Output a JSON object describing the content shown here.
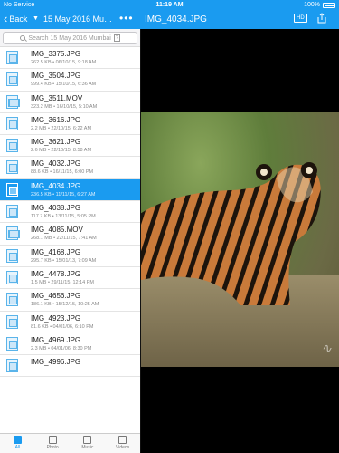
{
  "status": {
    "carrier": "No Service",
    "time": "11:19 AM",
    "battery": "100%"
  },
  "nav": {
    "back_label": "Back",
    "folder_title": "15 May 2016 Mumbai",
    "more": "•••",
    "file_title": "IMG_4034.JPG",
    "hd_label": "HD"
  },
  "search": {
    "placeholder": "Search 15 May 2016 Mumbai"
  },
  "files": [
    {
      "name": "IMG_3375.JPG",
      "meta": "262.5 KB • 06/10/15, 9:18 AM",
      "type": "image"
    },
    {
      "name": "IMG_3504.JPG",
      "meta": "999.4 KB • 15/10/15, 6:36 AM",
      "type": "image"
    },
    {
      "name": "IMG_3511.MOV",
      "meta": "323.2 MB • 16/10/15, 5:10 AM",
      "type": "video"
    },
    {
      "name": "IMG_3616.JPG",
      "meta": "2.2 MB • 22/10/15, 6:22 AM",
      "type": "image"
    },
    {
      "name": "IMG_3621.JPG",
      "meta": "2.6 MB • 22/10/15, 8:58 AM",
      "type": "image"
    },
    {
      "name": "IMG_4032.JPG",
      "meta": "88.6 KB • 16/11/15, 6:00 PM",
      "type": "image"
    },
    {
      "name": "IMG_4034.JPG",
      "meta": "236.5 KB • 11/11/15, 6:27 AM",
      "type": "image",
      "selected": true
    },
    {
      "name": "IMG_4038.JPG",
      "meta": "117.7 KB • 13/11/15, 5:05 PM",
      "type": "image"
    },
    {
      "name": "IMG_4085.MOV",
      "meta": "268.1 MB • 22/11/15, 7:41 AM",
      "type": "video"
    },
    {
      "name": "IMG_4168.JPG",
      "meta": "295.7 KB • 15/01/13, 7:09 AM",
      "type": "image"
    },
    {
      "name": "IMG_4478.JPG",
      "meta": "1.5 MB • 29/11/15, 12:14 PM",
      "type": "image"
    },
    {
      "name": "IMG_4656.JPG",
      "meta": "186.1 KB • 15/12/15, 10:25 AM",
      "type": "image"
    },
    {
      "name": "IMG_4923.JPG",
      "meta": "81.6 KB • 04/01/06, 6:10 PM",
      "type": "image"
    },
    {
      "name": "IMG_4969.JPG",
      "meta": "2.3 MB • 04/01/06, 8:30 PM",
      "type": "image"
    },
    {
      "name": "IMG_4996.JPG",
      "meta": "",
      "type": "image"
    }
  ],
  "tabs": [
    {
      "label": "All",
      "active": true
    },
    {
      "label": "Photo",
      "active": false
    },
    {
      "label": "Music",
      "active": false
    },
    {
      "label": "Videos",
      "active": false
    }
  ],
  "accent_color": "#1a9bf0"
}
